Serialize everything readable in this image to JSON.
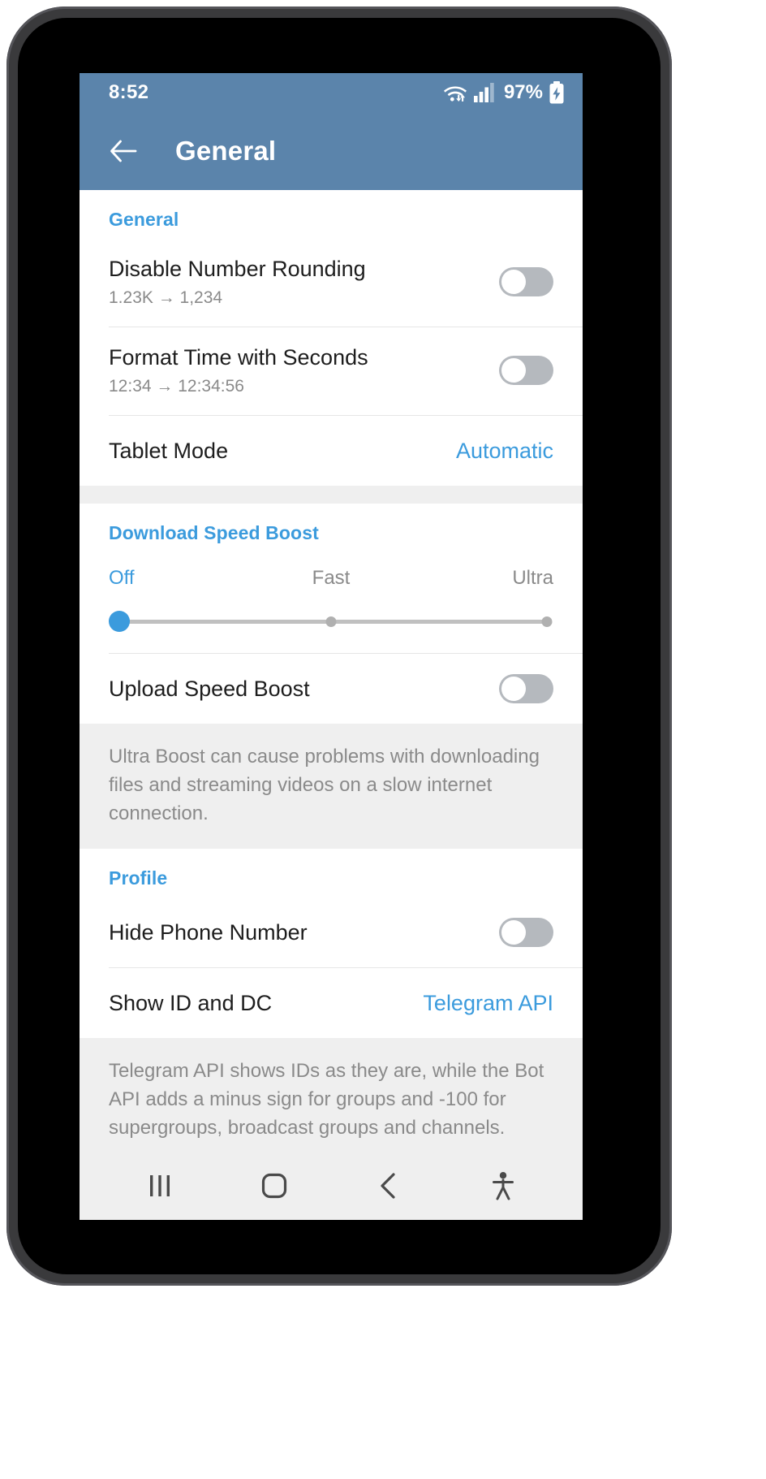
{
  "status_bar": {
    "time": "8:52",
    "battery_percent": "97%",
    "icons": [
      "wifi-icon",
      "cellular-signal-icon",
      "battery-charging-icon"
    ]
  },
  "app_bar": {
    "title": "General",
    "back_icon": "back-arrow-icon"
  },
  "colors": {
    "accent": "#3b9bdd",
    "app_bar": "#5b84ab",
    "divider": "#e6e6e6",
    "section_bg": "#efefef",
    "toggle_off_track": "#b5b9be",
    "secondary_text": "#8a8a8a"
  },
  "sections": [
    {
      "header": "General",
      "rows": [
        {
          "title": "Disable Number Rounding",
          "subtitle": "1.23K → 1,234",
          "control": "toggle",
          "toggle_on": false
        },
        {
          "title": "Format Time with Seconds",
          "subtitle": "12:34 → 12:34:56",
          "control": "toggle",
          "toggle_on": false
        },
        {
          "title": "Tablet Mode",
          "value": "Automatic",
          "control": "value"
        }
      ]
    },
    {
      "header": "Download Speed Boost",
      "slider": {
        "labels": [
          "Off",
          "Fast",
          "Ultra"
        ],
        "selected_index": 0,
        "selected_label": "Off",
        "steps": 3
      },
      "rows": [
        {
          "title": "Upload Speed Boost",
          "control": "toggle",
          "toggle_on": false
        }
      ],
      "note": "Ultra Boost can cause problems with downloading files and streaming videos on a slow internet connection."
    },
    {
      "header": "Profile",
      "rows": [
        {
          "title": "Hide Phone Number",
          "control": "toggle",
          "toggle_on": false
        },
        {
          "title": "Show ID and DC",
          "value": "Telegram API",
          "control": "value"
        }
      ],
      "note": "Telegram API shows IDs as they are, while the Bot API adds a minus sign for groups and -100 for supergroups, broadcast groups and channels."
    }
  ],
  "nav_bar": {
    "buttons": [
      {
        "name": "recents-button",
        "icon": "recents-icon"
      },
      {
        "name": "home-button",
        "icon": "home-square-icon"
      },
      {
        "name": "back-button",
        "icon": "chevron-left-icon"
      },
      {
        "name": "accessibility-button",
        "icon": "accessibility-person-icon"
      }
    ]
  }
}
